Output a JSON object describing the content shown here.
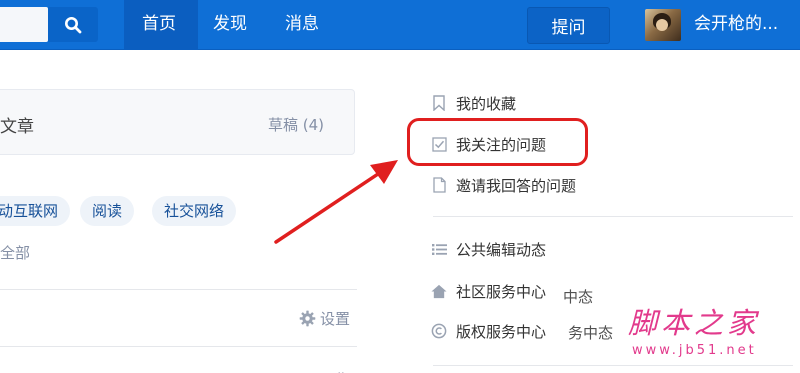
{
  "topbar": {
    "nav": [
      "首页",
      "发现",
      "消息"
    ],
    "ask_label": "提问",
    "username": "会开枪的..."
  },
  "left": {
    "draft_article": "文章",
    "draft_label": "草稿 (4)",
    "tags": [
      "动互联网",
      "阅读",
      "社交网络"
    ],
    "all_link": "全部",
    "settings_label": "设置"
  },
  "sidebar": {
    "items": [
      {
        "label": "我的收藏",
        "icon": "bookmark-icon"
      },
      {
        "label": "我关注的问题",
        "icon": "checkbox-icon"
      },
      {
        "label": "邀请我回答的问题",
        "icon": "document-icon"
      },
      {
        "label": "公共编辑动态",
        "icon": "list-icon"
      },
      {
        "label": "社区服务中心",
        "icon": "home-icon"
      },
      {
        "label": "版权服务中心",
        "icon": "copyright-icon"
      }
    ],
    "overlap_text_1": "中态",
    "overlap_text_2": "务中态"
  },
  "watermark": {
    "title": "脚本之家",
    "url": "www.jb51.net"
  },
  "colors": {
    "topbar": "#0f6fd6",
    "highlight": "#e01f1f",
    "watermark": "#e23a8c"
  }
}
